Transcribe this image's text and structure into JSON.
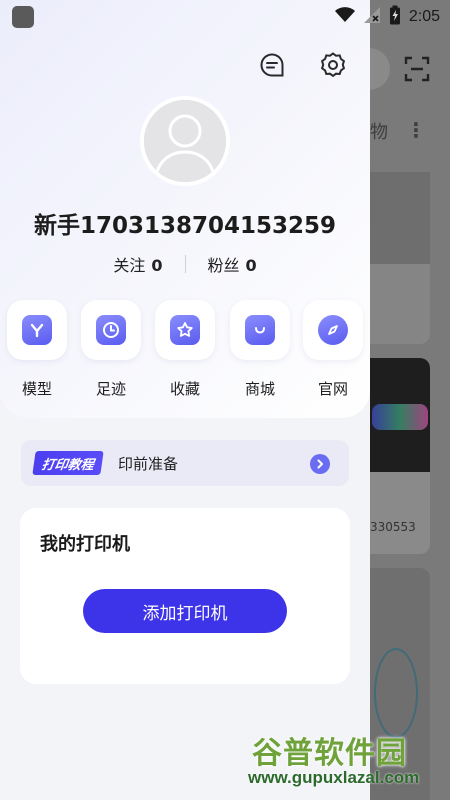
{
  "status_bar": {
    "time": "2:05"
  },
  "background": {
    "tab_fragment": "物",
    "card_text_fragment": "330553"
  },
  "profile": {
    "username": "新手1703138704153259",
    "follow_label": "关注",
    "follow_count": "0",
    "fans_label": "粉丝",
    "fans_count": "0"
  },
  "menu": [
    {
      "label": "模型",
      "icon": "model-icon",
      "glyph": "Y"
    },
    {
      "label": "足迹",
      "icon": "footprint-clock-icon",
      "glyph": "clock"
    },
    {
      "label": "收藏",
      "icon": "favorite-star-icon",
      "glyph": "star"
    },
    {
      "label": "商城",
      "icon": "shop-bag-icon",
      "glyph": "bag"
    },
    {
      "label": "官网",
      "icon": "official-site-compass-icon",
      "glyph": "compass"
    }
  ],
  "tutorial": {
    "badge": "打印教程",
    "text": "印前准备"
  },
  "printer": {
    "title": "我的打印机",
    "add_button": "添加打印机"
  },
  "watermark": {
    "title": "谷普软件园",
    "url": "www.gupuxlazal.com"
  },
  "colors": {
    "accent": "#3d33e8",
    "icon_gradient": "#6a6df2",
    "drawer_bg": "#f3f4f8",
    "watermark": "#6fa23a"
  }
}
